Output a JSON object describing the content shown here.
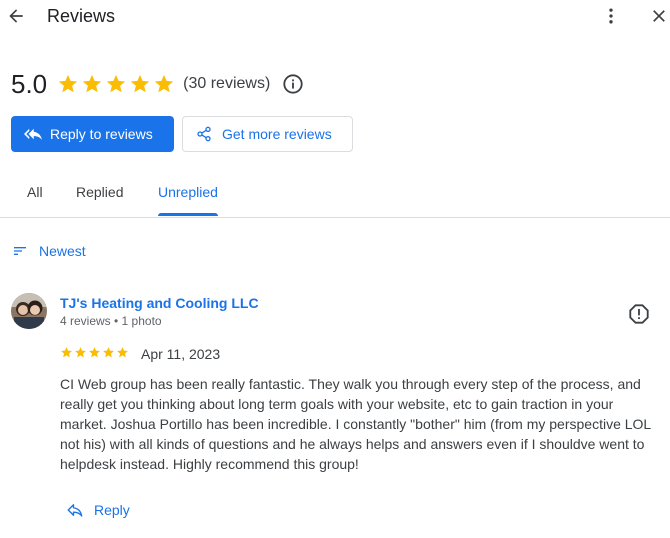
{
  "header": {
    "title": "Reviews",
    "back_icon": "arrow-back-icon",
    "more_icon": "more-vert-icon",
    "close_icon": "close-icon"
  },
  "summary": {
    "rating": "5.0",
    "stars": 5,
    "count_text": "(30 reviews)",
    "star_color": "#fbbc04"
  },
  "actions": {
    "reply_to_reviews": "Reply to reviews",
    "get_more_reviews": "Get more reviews"
  },
  "tabs": [
    {
      "label": "All",
      "active": false
    },
    {
      "label": "Replied",
      "active": false
    },
    {
      "label": "Unreplied",
      "active": true
    }
  ],
  "sort": {
    "label": "Newest"
  },
  "review": {
    "author": "TJ's Heating and Cooling LLC",
    "meta": "4 reviews • 1 photo",
    "stars": 5,
    "date": "Apr 11, 2023",
    "text": "CI Web group has been really fantastic. They walk you through every step of the process, and really get you thinking about long term goals with your website, etc to gain traction in your market. Joshua Portillo has been incredible. I constantly \"bother\" him (from my perspective LOL not his) with all kinds of questions and he always helps and answers even if I shouldve went to helpdesk instead. Highly recommend this group!",
    "reply_label": "Reply"
  },
  "colors": {
    "accent": "#1a73e8",
    "star": "#fbbc04",
    "divider": "#dadce0"
  }
}
